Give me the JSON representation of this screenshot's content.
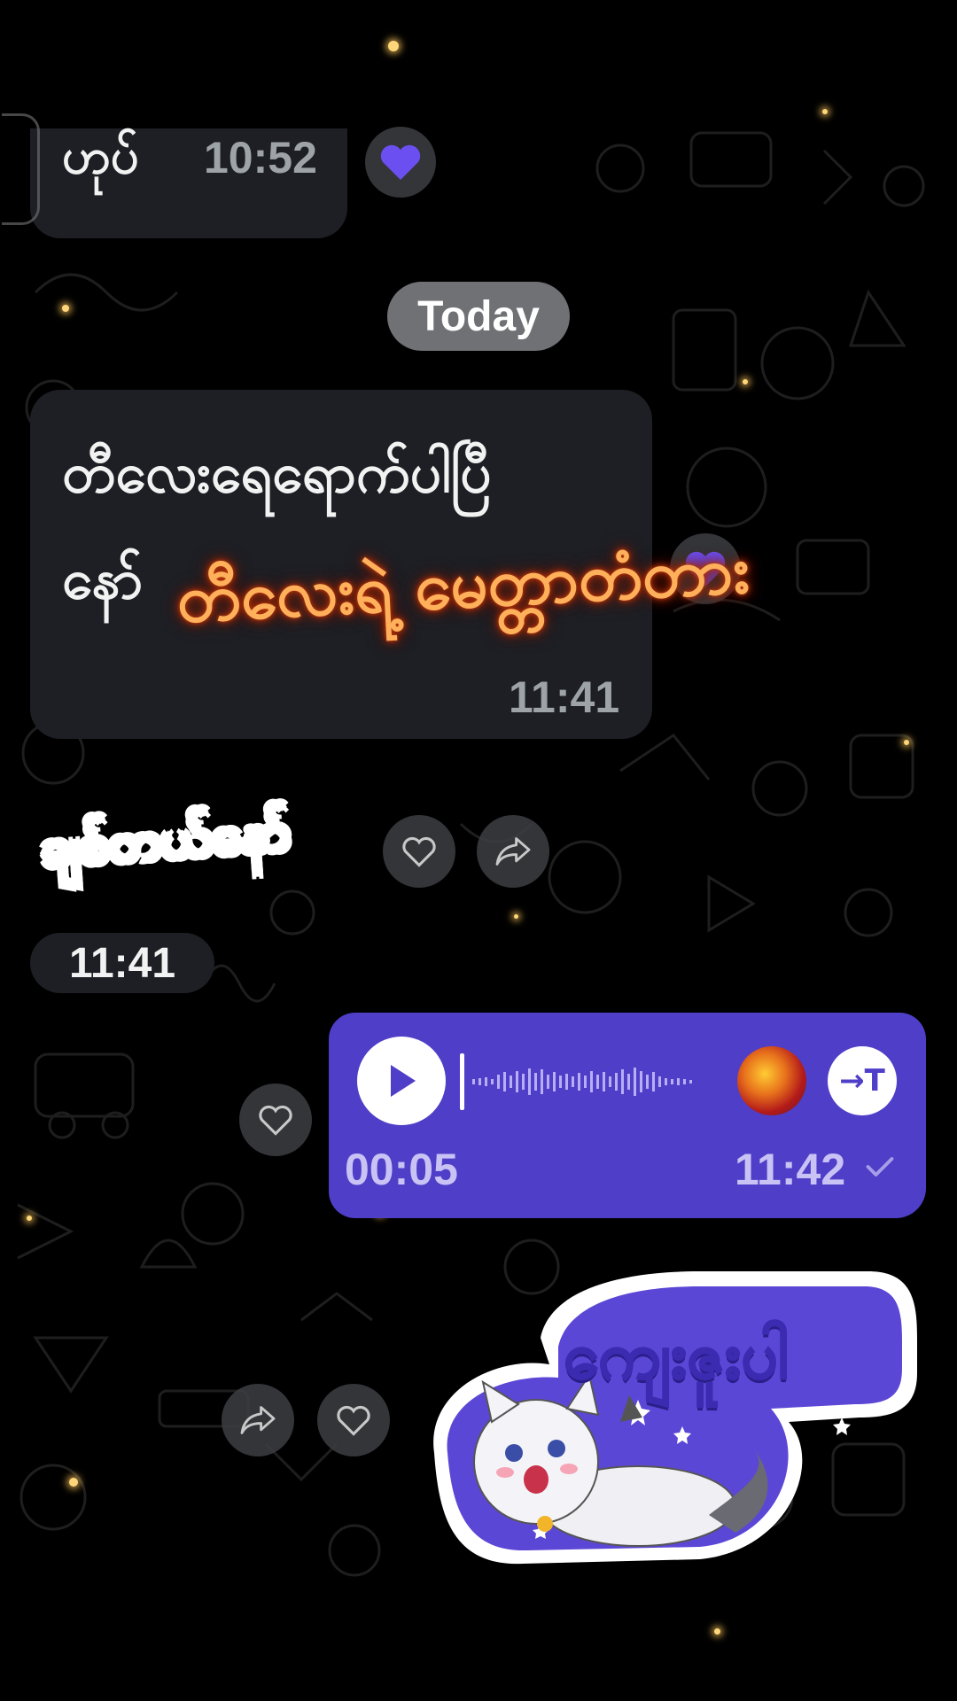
{
  "messages": [
    {
      "text": "ဟုပ်",
      "time": "10:52",
      "reaction": "heart-purple"
    },
    {
      "text_line1": "တီလေးရေရောက်ပါပြီ",
      "text_line2": "နော်",
      "time": "11:41",
      "reaction": "heart-purple"
    },
    {
      "sticker_text": "ချစ်တယ်နော်",
      "time": "11:41"
    },
    {
      "type": "voice",
      "duration": "00:05",
      "time": "11:42",
      "status": "sent"
    },
    {
      "sticker_text": "ကျေးဇူးပါ"
    }
  ],
  "date_divider": "Today",
  "overlay_caption": "တီလေးရဲ့ မေတ္တာတံတား",
  "voice": {
    "transcribe_label": "→T"
  },
  "colors": {
    "accent": "#4f3ec7",
    "incoming_bubble": "#1d1f24",
    "heart": "#6b4ff0",
    "caption": "#ffb05a"
  },
  "icons": [
    "heart-icon",
    "share-icon",
    "play-icon",
    "transcribe-icon",
    "check-icon"
  ]
}
